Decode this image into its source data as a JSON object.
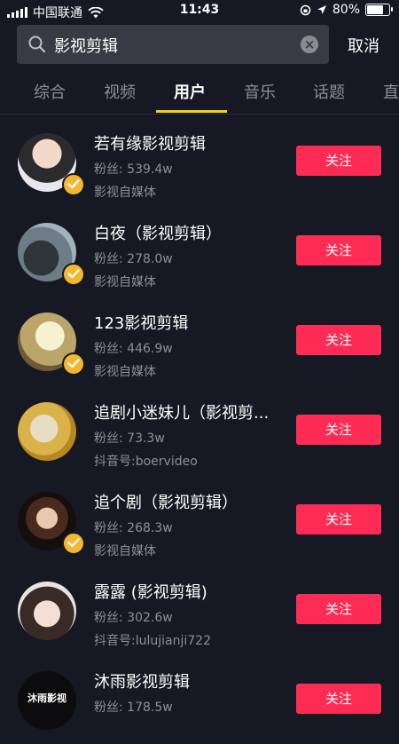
{
  "status_bar": {
    "carrier": "中国联通",
    "time": "11:43",
    "battery_text": "80%",
    "battery_level": 0.8
  },
  "search": {
    "query": "影视剪辑",
    "cancel_label": "取消"
  },
  "tabs": [
    "综合",
    "视频",
    "用户",
    "音乐",
    "话题",
    "直"
  ],
  "active_tab": "用户",
  "users": [
    {
      "name": "若有缘影视剪辑",
      "followers": "粉丝: 539.4w",
      "desc": "影视自媒体",
      "verified": true,
      "follow_label": "关注"
    },
    {
      "name": "白夜（影视剪辑）",
      "followers": "粉丝: 278.0w",
      "desc": "影视自媒体",
      "verified": true,
      "follow_label": "关注"
    },
    {
      "name": "123影视剪辑",
      "followers": "粉丝: 446.9w",
      "desc": "影视自媒体",
      "verified": true,
      "follow_label": "关注"
    },
    {
      "name": "追剧小迷妹儿（影视剪...",
      "followers": "粉丝: 73.3w",
      "desc": "抖音号:boervideo",
      "verified": false,
      "follow_label": "关注"
    },
    {
      "name": "追个剧（影视剪辑）",
      "followers": "粉丝: 268.3w",
      "desc": "影视自媒体",
      "verified": true,
      "follow_label": "关注"
    },
    {
      "name": "露露 (影视剪辑)",
      "followers": "粉丝: 302.6w",
      "desc": "抖音号:lulujianji722",
      "verified": false,
      "follow_label": "关注"
    },
    {
      "name": "沐雨影视剪辑",
      "followers": "粉丝: 178.5w",
      "desc": "",
      "verified": false,
      "follow_label": "关注",
      "avatar_text": "沐雨影视"
    }
  ],
  "colors": {
    "background": "#161823",
    "accent_follow": "#fe2c55",
    "tab_indicator": "#face15",
    "verified_badge": "#f5b731"
  }
}
